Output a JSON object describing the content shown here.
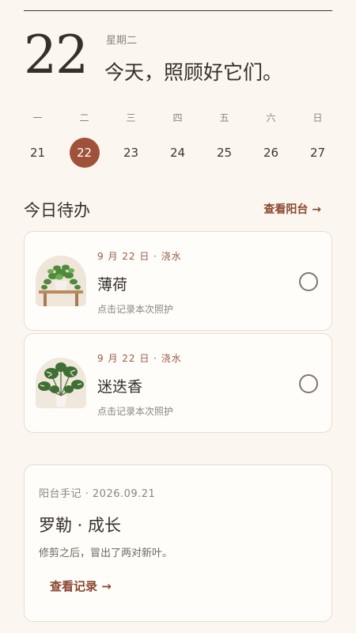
{
  "header": {
    "day_number": "22",
    "weekday": "星期二",
    "headline": "今天，照顾好它们。"
  },
  "week": {
    "heads": [
      "一",
      "二",
      "三",
      "四",
      "五",
      "六",
      "日"
    ],
    "days": [
      "21",
      "22",
      "23",
      "24",
      "25",
      "26",
      "27"
    ],
    "selected_index": 1
  },
  "today": {
    "title": "今日待办",
    "link_label": "查看阳台 →"
  },
  "tasks": [
    {
      "meta": "9 月 22 日 · 浇水",
      "name": "薄荷",
      "hint": "点击记录本次照护",
      "image": "pothos-plant"
    },
    {
      "meta": "9 月 22 日 · 浇水",
      "name": "迷迭香",
      "hint": "点击记录本次照护",
      "image": "monstera-plant"
    }
  ],
  "journal": {
    "meta": "阳台手记 · 2026.09.21",
    "title": "罗勒 · 成长",
    "body": "修剪之后，冒出了两对新叶。",
    "link_label": "查看记录 →"
  },
  "colors": {
    "background": "#fbf6ef",
    "accent": "#a0513a",
    "link": "#8b4630"
  }
}
